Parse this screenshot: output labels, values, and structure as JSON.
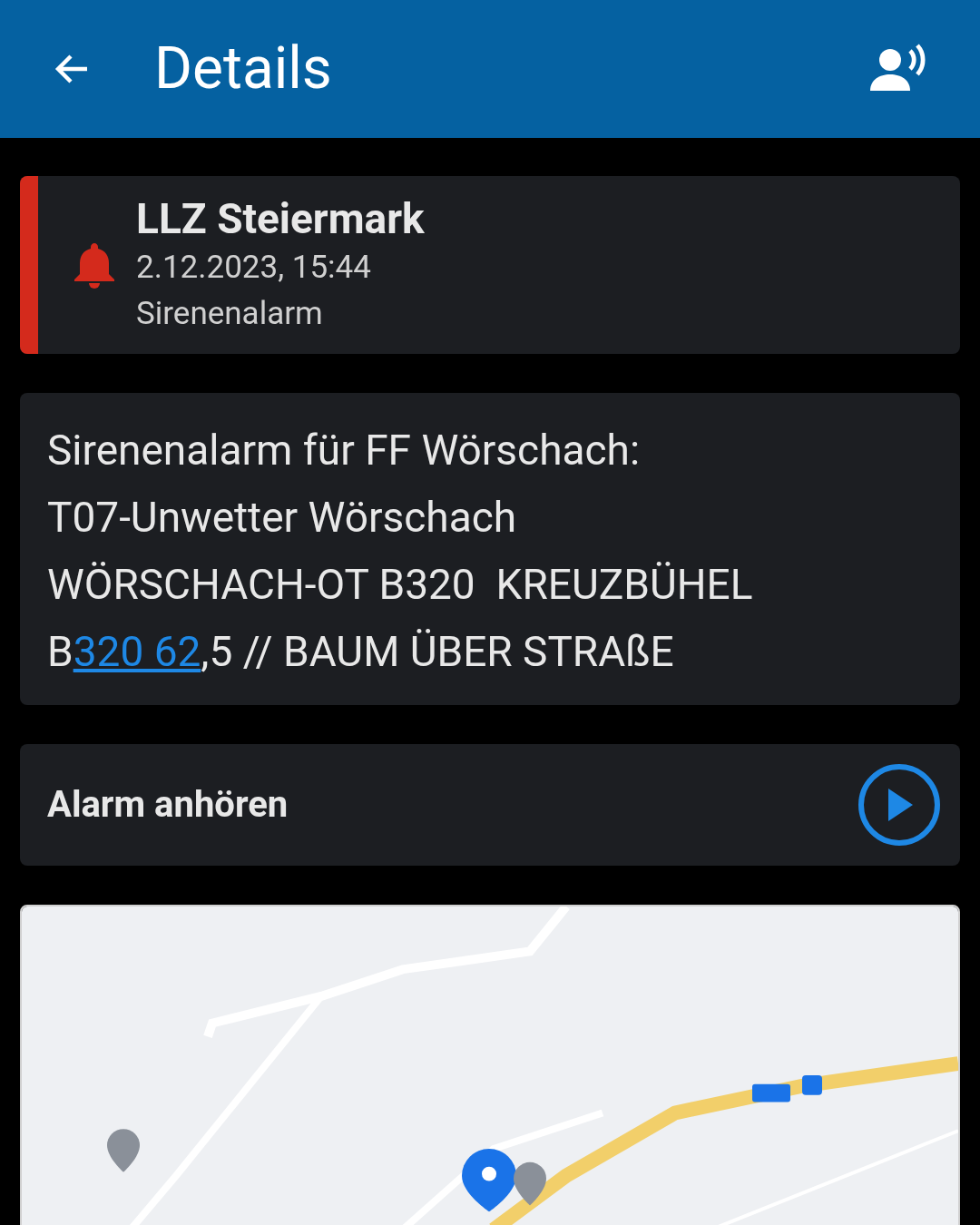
{
  "app_bar": {
    "title": "Details"
  },
  "alarm": {
    "source": "LLZ Steiermark",
    "time": "2.12.2023, 15:44",
    "type": "Sirenenalarm",
    "color": "#d42a1c"
  },
  "message": {
    "lines": [
      "Sirenenalarm für FF Wörschach:",
      "T07-Unwetter Wörschach",
      "WÖRSCHACH-OT B320  KREUZBÜHEL"
    ],
    "last_line": {
      "before": "B",
      "link": "320 62",
      "after": ",5 // BAUM ÜBER STRAßE"
    }
  },
  "audio": {
    "label": "Alarm anhören"
  }
}
